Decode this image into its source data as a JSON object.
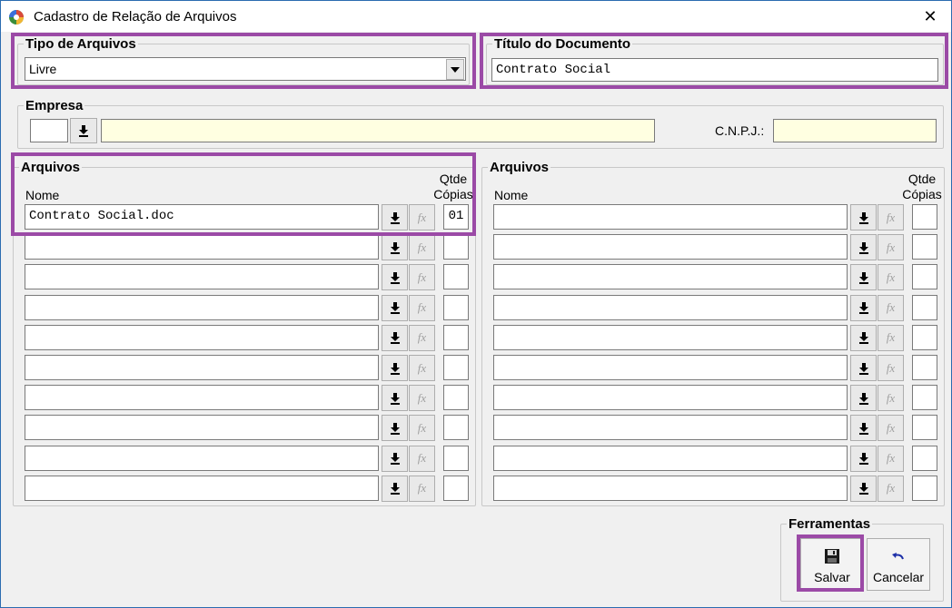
{
  "window": {
    "title": "Cadastro de Relação de Arquivos",
    "close_glyph": "✕"
  },
  "tipo": {
    "legend": "Tipo de Arquivos",
    "selected": "Livre"
  },
  "titulo": {
    "legend": "Título do Documento",
    "value": "Contrato Social"
  },
  "empresa": {
    "legend": "Empresa",
    "code": "",
    "name": "",
    "cnpj_label": "C.N.P.J.:",
    "cnpj": ""
  },
  "arquivos_left": {
    "legend": "Arquivos",
    "nome_label": "Nome",
    "qtde_label": "Qtde",
    "copias_label": "Cópias",
    "rows": [
      {
        "nome": "Contrato Social.doc",
        "qtde": "01"
      },
      {
        "nome": "",
        "qtde": ""
      },
      {
        "nome": "",
        "qtde": ""
      },
      {
        "nome": "",
        "qtde": ""
      },
      {
        "nome": "",
        "qtde": ""
      },
      {
        "nome": "",
        "qtde": ""
      },
      {
        "nome": "",
        "qtde": ""
      },
      {
        "nome": "",
        "qtde": ""
      },
      {
        "nome": "",
        "qtde": ""
      },
      {
        "nome": "",
        "qtde": ""
      }
    ]
  },
  "arquivos_right": {
    "legend": "Arquivos",
    "nome_label": "Nome",
    "qtde_label": "Qtde",
    "copias_label": "Cópias",
    "rows": [
      {
        "nome": "",
        "qtde": ""
      },
      {
        "nome": "",
        "qtde": ""
      },
      {
        "nome": "",
        "qtde": ""
      },
      {
        "nome": "",
        "qtde": ""
      },
      {
        "nome": "",
        "qtde": ""
      },
      {
        "nome": "",
        "qtde": ""
      },
      {
        "nome": "",
        "qtde": ""
      },
      {
        "nome": "",
        "qtde": ""
      },
      {
        "nome": "",
        "qtde": ""
      },
      {
        "nome": "",
        "qtde": ""
      }
    ]
  },
  "ferramentas": {
    "legend": "Ferramentas",
    "salvar": "Salvar",
    "cancelar": "Cancelar"
  },
  "icons": {
    "fx": "fx",
    "download": "download-arrow-icon",
    "save": "floppy-disk-icon",
    "undo": "undo-icon"
  },
  "colors": {
    "highlight": "#9b4aa6",
    "readonly_field": "#ffffe1"
  }
}
